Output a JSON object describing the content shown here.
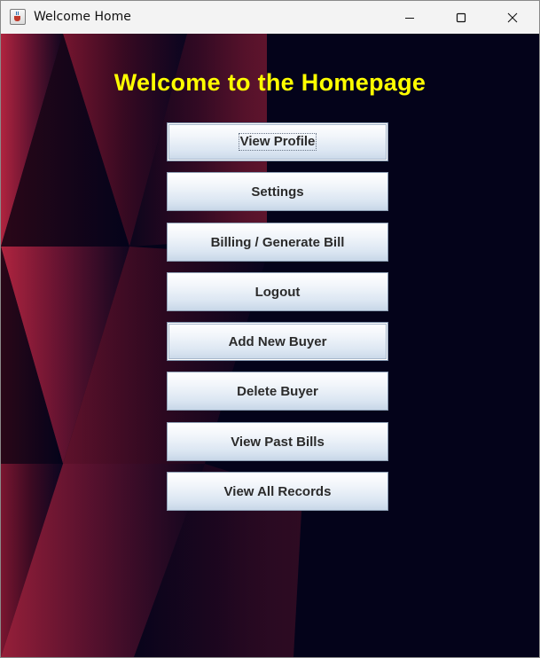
{
  "window": {
    "title": "Welcome Home",
    "app_icon": "java-cup-icon",
    "controls": [
      "minimize-icon",
      "maximize-icon",
      "close-icon"
    ]
  },
  "main": {
    "heading": "Welcome to the Homepage",
    "heading_color": "#ffff00",
    "background_color": "#04031a",
    "buttons": [
      {
        "label": "View Profile",
        "focused": true
      },
      {
        "label": "Settings"
      },
      {
        "label": "Billing / Generate Bill"
      },
      {
        "label": "Logout"
      },
      {
        "label": "Add New Buyer",
        "highlighted": true
      },
      {
        "label": "Delete Buyer"
      },
      {
        "label": "View Past Bills"
      },
      {
        "label": "View All Records"
      }
    ]
  }
}
